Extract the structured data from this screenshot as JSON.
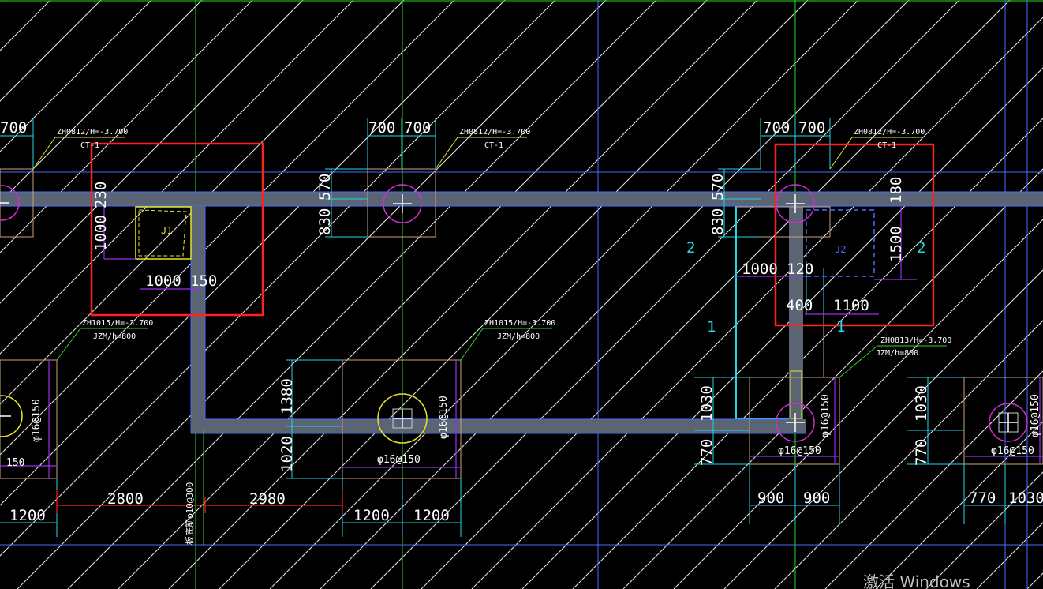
{
  "colors": {
    "background": "#000000",
    "axis_green": "#22dd22",
    "axis_blue": "#4a6cff",
    "hatch": "#e8e8e8",
    "beam": "#5a6473",
    "pile_circle": "#d22cd2",
    "pile_circle_yellow": "#e6e62a",
    "dim_cyan": "#23d6e6",
    "highlight_red": "#ff2020",
    "purple": "#9b2cf0",
    "leader_yellow": "#e6e62a",
    "leader_green": "#2bd62b"
  },
  "labels": {
    "pile_cap_tag_1": "ZH0812/H=-3.700",
    "pile_cap_tag_1b": "CT-1",
    "pile_cap_tag_2": "ZH0812/H=-3.700",
    "pile_cap_tag_2b": "CT-1",
    "pile_cap_tag_3": "ZH0812/H=-3.700",
    "pile_cap_tag_3b": "CT-1",
    "pile_tag_4": "ZH1015/H=-3.700",
    "pile_tag_4b": "JZM/h=800",
    "pile_tag_5": "ZH1015/H=-3.700",
    "pile_tag_5b": "JZM/h=800",
    "pile_tag_6": "ZH0813/H=-3.700",
    "pile_tag_6b": "JZM/h=800",
    "j1": "J1",
    "j2": "J2",
    "rebar_note": "板底筋φ10@300"
  },
  "dimensions": {
    "top_left_partial": "700",
    "top_mid_a": "700",
    "top_mid_b": "700",
    "top_right_a": "700",
    "top_right_b": "700",
    "j1_230": "230",
    "j1_1000v": "1000",
    "j1_1000h": "1000",
    "j1_150": "150",
    "mid_570": "570",
    "mid_830": "830",
    "right_570": "570",
    "right_830": "830",
    "right_1000": "1000",
    "right_120": "120",
    "right_180": "180",
    "right_1500": "1500",
    "right_400": "400",
    "right_1100": "1100",
    "label_2a": "2",
    "label_2b": "2",
    "label_1a": "1",
    "label_1b": "1",
    "cap_1380": "1380",
    "cap_1020": "1020",
    "cap_1030": "1030",
    "cap_770": "770",
    "cap_1030b": "1030",
    "cap_770b": "770",
    "rebar_left_v": "φ16@150",
    "rebar_left_h": "150",
    "rebar_mid_v": "φ16@150",
    "rebar_mid_h": "φ16@150",
    "rebar_right_v": "φ16@150",
    "rebar_right_h": "φ16@150",
    "rebar_far_v": "φ16@150",
    "rebar_far_h": "φ16@150",
    "bot_2800": "2800",
    "bot_2980": "2980",
    "bot_1200_left": "1200",
    "bot_1200_a": "1200",
    "bot_1200_b": "1200",
    "bot_900_a": "900",
    "bot_900_b": "900",
    "bot_770": "770",
    "bot_1030": "1030"
  },
  "watermark": "激活 Windows"
}
